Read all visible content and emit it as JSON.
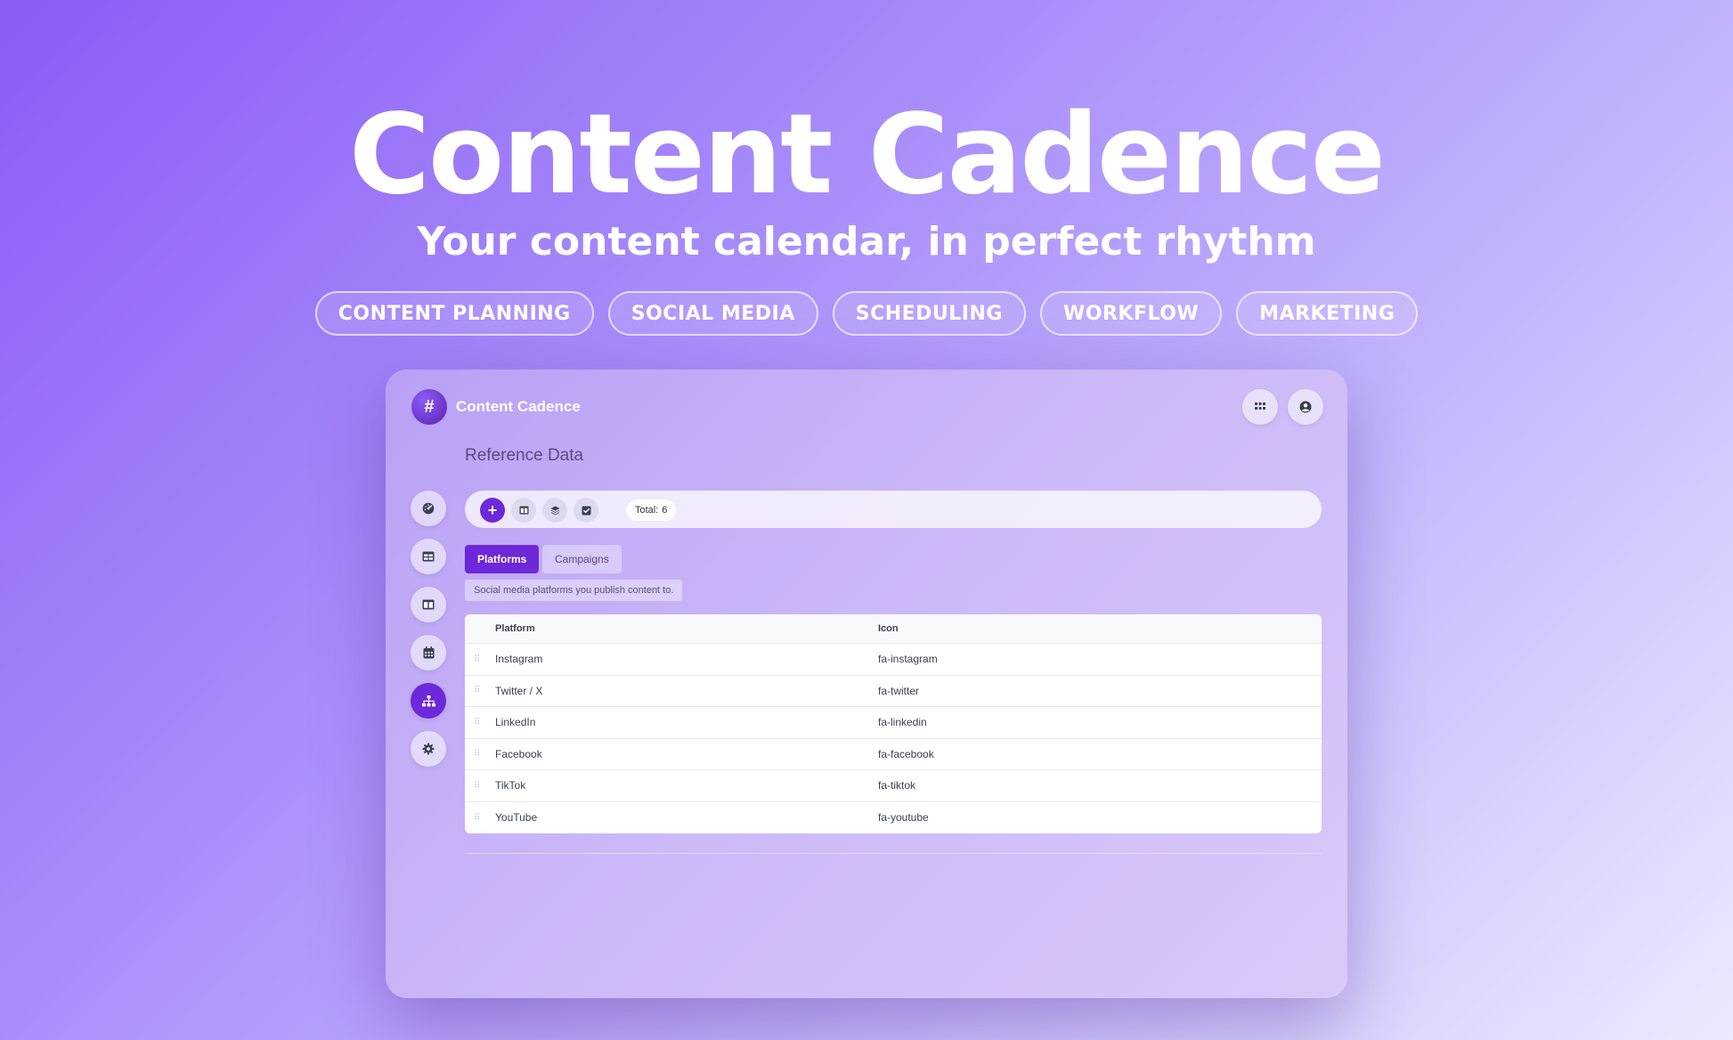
{
  "hero": {
    "title": "Content Cadence",
    "subtitle": "Your content calendar, in perfect rhythm",
    "tags": [
      "CONTENT PLANNING",
      "SOCIAL MEDIA",
      "SCHEDULING",
      "WORKFLOW",
      "MARKETING"
    ]
  },
  "app": {
    "logo_glyph": "#",
    "name": "Content Cadence",
    "page_heading": "Reference Data",
    "header_icons": [
      "apps-grid-icon",
      "user-circle-icon"
    ],
    "sidebar_icons": [
      "dashboard-gauge-icon",
      "table-icon",
      "columns-icon",
      "calendar-icon",
      "sitemap-icon",
      "gear-icon"
    ],
    "sidebar_active_index": 4
  },
  "toolbar": {
    "add_glyph": "+",
    "icons": [
      "add-icon",
      "columns-icon",
      "layers-icon",
      "check-square-icon"
    ],
    "total_label": "Total:",
    "total_value": "6"
  },
  "tabs": {
    "platforms": "Platforms",
    "campaigns": "Campaigns",
    "description": "Social media platforms you publish content to."
  },
  "table": {
    "columns": [
      "Platform",
      "Icon"
    ],
    "rows": [
      {
        "platform": "Instagram",
        "icon": "fa-instagram"
      },
      {
        "platform": "Twitter / X",
        "icon": "fa-twitter"
      },
      {
        "platform": "LinkedIn",
        "icon": "fa-linkedin"
      },
      {
        "platform": "Facebook",
        "icon": "fa-facebook"
      },
      {
        "platform": "TikTok",
        "icon": "fa-tiktok"
      },
      {
        "platform": "YouTube",
        "icon": "fa-youtube"
      }
    ],
    "drag_handle_glyph": "⠿"
  },
  "colors": {
    "accent": "#6d28d9",
    "background_start": "#8b5cf6",
    "background_end": "#ede9fe"
  }
}
